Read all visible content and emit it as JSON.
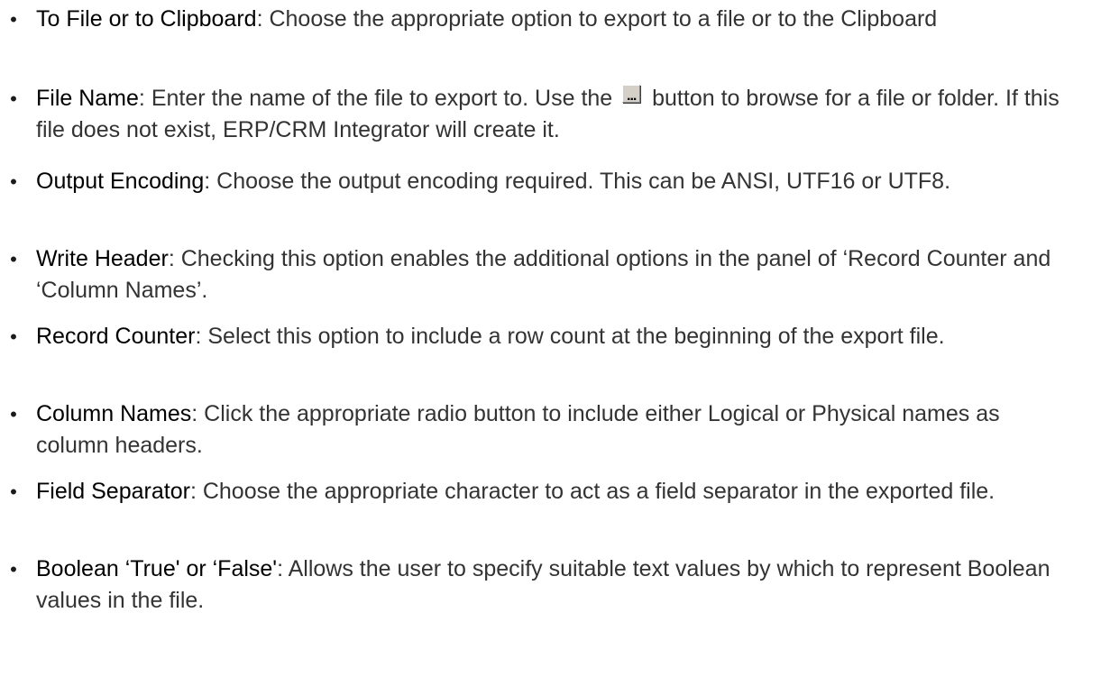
{
  "items": [
    {
      "term": "To File or to Clipboard",
      "desc": ": Choose the appropriate option to export to a file or to the Clipboard"
    },
    {
      "term": "File Name",
      "desc_before_icon": ": Enter the name of the file to export to. Use the ",
      "icon_glyph": "...",
      "desc_after_icon": " button to browse for a file or folder. If this file does not exist, ERP/CRM Integrator will create it."
    },
    {
      "term": "Output Encoding",
      "desc": ": Choose the output encoding required.  This can be ANSI, UTF16 or UTF8."
    },
    {
      "term": "Write Header",
      "desc": ": Checking this option enables the additional options in the panel of ‘Record Counter and ‘Column Names’."
    },
    {
      "term": "Record Counter",
      "desc": ": Select this option to include a row count at the beginning of the export file."
    },
    {
      "term": "Column Names",
      "desc": ": Click the appropriate radio button to include either Logical or Phys­ical names as column headers."
    },
    {
      "term": "Field Separator",
      "desc": ": Choose the appropriate character to act as a field separator in the exported file."
    },
    {
      "term": "Boolean ‘True' or ‘False'",
      "desc": ": Allows the user to specify suitable text values by which to represent Boolean values in the file."
    }
  ],
  "bullet_char": "•"
}
